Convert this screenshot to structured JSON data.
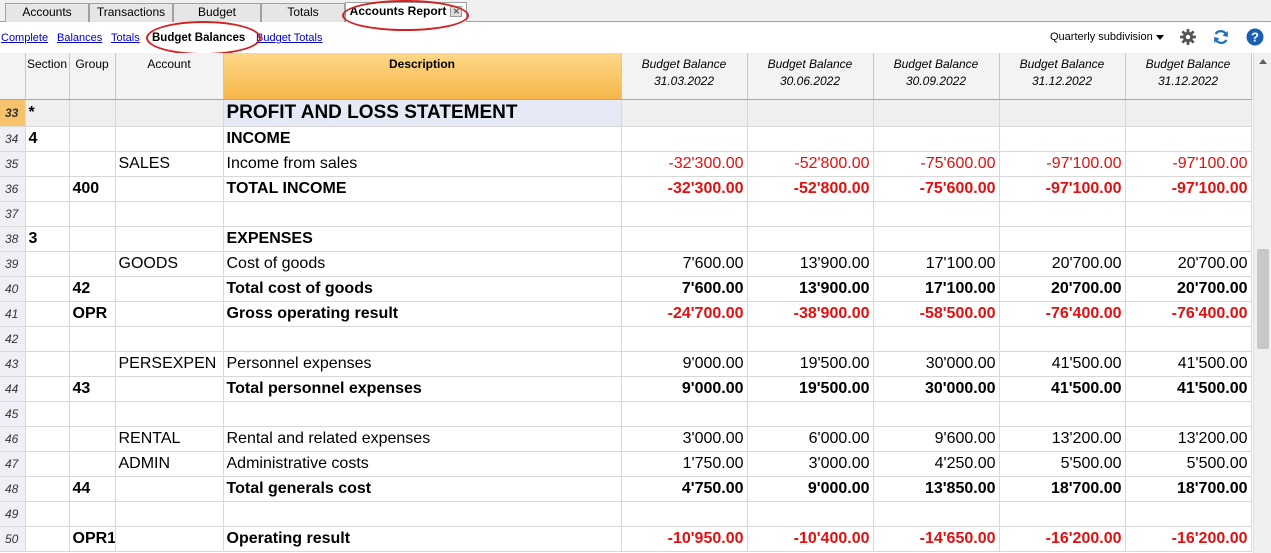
{
  "tabs": [
    {
      "label": "Accounts",
      "active": false
    },
    {
      "label": "Transactions",
      "active": false
    },
    {
      "label": "Budget",
      "active": false
    },
    {
      "label": "Totals",
      "active": false
    },
    {
      "label": "Accounts Report",
      "active": true
    }
  ],
  "links": [
    {
      "label": "Complete",
      "active": false
    },
    {
      "label": "Balances",
      "active": false
    },
    {
      "label": "Totals",
      "active": false
    },
    {
      "label": "Budget Balances",
      "active": true
    },
    {
      "label": "Budget Totals",
      "active": false
    }
  ],
  "subdivision": {
    "label": "Quarterly subdivision"
  },
  "toolbar_icons": [
    "gear-icon",
    "refresh-icon",
    "help-icon"
  ],
  "colors": {
    "negative": "#e01010",
    "link": "#0000cc",
    "description_header": "#f6b648",
    "annotation": "#d42020"
  },
  "columns": {
    "section": "Section",
    "group": "Group",
    "account": "Account",
    "description": "Description",
    "balances": [
      {
        "label": "Budget Balance",
        "date": "31.03.2022"
      },
      {
        "label": "Budget Balance",
        "date": "30.06.2022"
      },
      {
        "label": "Budget Balance",
        "date": "30.09.2022"
      },
      {
        "label": "Budget Balance",
        "date": "31.12.2022"
      },
      {
        "label": "Budget Balance",
        "date": "31.12.2022"
      }
    ]
  },
  "rows": [
    {
      "n": "33",
      "section": "*",
      "group": "",
      "account": "",
      "description": "PROFIT AND LOSS STATEMENT",
      "values": [
        "",
        "",
        "",
        "",
        ""
      ],
      "style": "hdr"
    },
    {
      "n": "34",
      "section": "4",
      "group": "",
      "account": "",
      "description": "INCOME",
      "values": [
        "",
        "",
        "",
        "",
        ""
      ],
      "style": "bold"
    },
    {
      "n": "35",
      "section": "",
      "group": "",
      "account": "SALES",
      "description": "Income from sales",
      "values": [
        "-32'300.00",
        "-52'800.00",
        "-75'600.00",
        "-97'100.00",
        "-97'100.00"
      ],
      "style": "normal",
      "red": true
    },
    {
      "n": "36",
      "section": "",
      "group": "400",
      "account": "",
      "description": "TOTAL INCOME",
      "values": [
        "-32'300.00",
        "-52'800.00",
        "-75'600.00",
        "-97'100.00",
        "-97'100.00"
      ],
      "style": "bold",
      "red": true
    },
    {
      "n": "37",
      "section": "",
      "group": "",
      "account": "",
      "description": "",
      "values": [
        "",
        "",
        "",
        "",
        ""
      ],
      "style": "normal"
    },
    {
      "n": "38",
      "section": "3",
      "group": "",
      "account": "",
      "description": "EXPENSES",
      "values": [
        "",
        "",
        "",
        "",
        ""
      ],
      "style": "bold"
    },
    {
      "n": "39",
      "section": "",
      "group": "",
      "account": "GOODS",
      "description": "Cost of goods",
      "values": [
        "7'600.00",
        "13'900.00",
        "17'100.00",
        "20'700.00",
        "20'700.00"
      ],
      "style": "normal"
    },
    {
      "n": "40",
      "section": "",
      "group": "42",
      "account": "",
      "description": "Total cost of goods",
      "values": [
        "7'600.00",
        "13'900.00",
        "17'100.00",
        "20'700.00",
        "20'700.00"
      ],
      "style": "bold"
    },
    {
      "n": "41",
      "section": "",
      "group": "OPR",
      "account": "",
      "description": "Gross operating result",
      "values": [
        "-24'700.00",
        "-38'900.00",
        "-58'500.00",
        "-76'400.00",
        "-76'400.00"
      ],
      "style": "bold",
      "red": true
    },
    {
      "n": "42",
      "section": "",
      "group": "",
      "account": "",
      "description": "",
      "values": [
        "",
        "",
        "",
        "",
        ""
      ],
      "style": "normal"
    },
    {
      "n": "43",
      "section": "",
      "group": "",
      "account": "PERSEXPEN",
      "description": "Personnel expenses",
      "values": [
        "9'000.00",
        "19'500.00",
        "30'000.00",
        "41'500.00",
        "41'500.00"
      ],
      "style": "normal"
    },
    {
      "n": "44",
      "section": "",
      "group": "43",
      "account": "",
      "description": "Total personnel expenses",
      "values": [
        "9'000.00",
        "19'500.00",
        "30'000.00",
        "41'500.00",
        "41'500.00"
      ],
      "style": "bold"
    },
    {
      "n": "45",
      "section": "",
      "group": "",
      "account": "",
      "description": "",
      "values": [
        "",
        "",
        "",
        "",
        ""
      ],
      "style": "normal"
    },
    {
      "n": "46",
      "section": "",
      "group": "",
      "account": "RENTAL",
      "description": "Rental and related expenses",
      "values": [
        "3'000.00",
        "6'000.00",
        "9'600.00",
        "13'200.00",
        "13'200.00"
      ],
      "style": "normal"
    },
    {
      "n": "47",
      "section": "",
      "group": "",
      "account": "ADMIN",
      "description": "Administrative costs",
      "values": [
        "1'750.00",
        "3'000.00",
        "4'250.00",
        "5'500.00",
        "5'500.00"
      ],
      "style": "normal"
    },
    {
      "n": "48",
      "section": "",
      "group": "44",
      "account": "",
      "description": "Total generals cost",
      "values": [
        "4'750.00",
        "9'000.00",
        "13'850.00",
        "18'700.00",
        "18'700.00"
      ],
      "style": "bold"
    },
    {
      "n": "49",
      "section": "",
      "group": "",
      "account": "",
      "description": "",
      "values": [
        "",
        "",
        "",
        "",
        ""
      ],
      "style": "normal"
    },
    {
      "n": "50",
      "section": "",
      "group": "OPR1",
      "account": "",
      "description": "Operating result",
      "values": [
        "-10'950.00",
        "-10'400.00",
        "-14'650.00",
        "-16'200.00",
        "-16'200.00"
      ],
      "style": "bold",
      "red": true
    }
  ]
}
